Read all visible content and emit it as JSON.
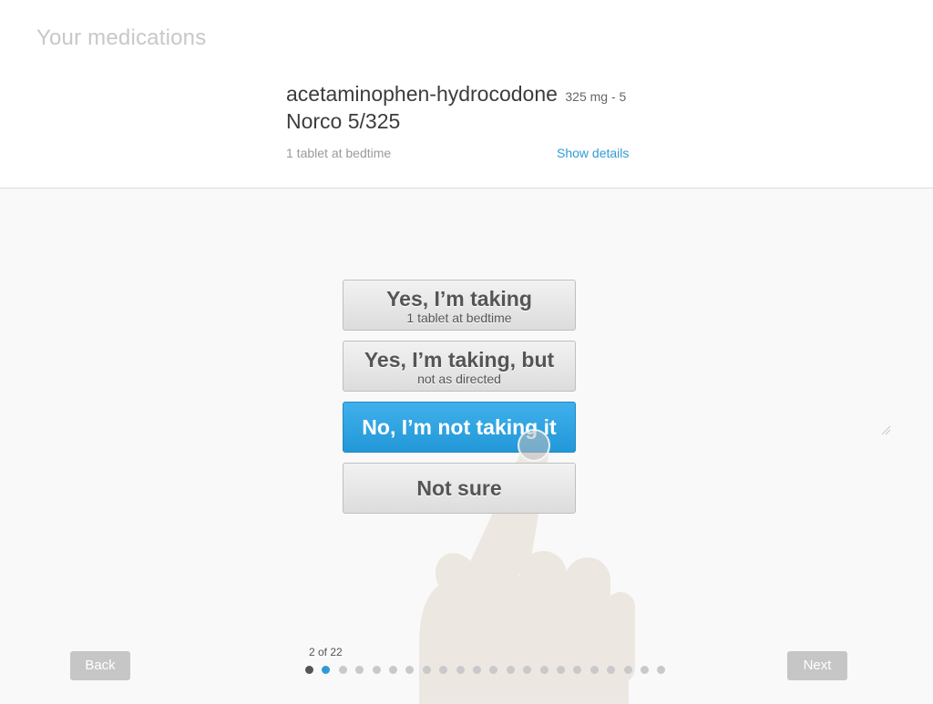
{
  "header": {
    "title": "Your medications",
    "medication": {
      "name": "acetaminophen-hydrocodone",
      "dose": "325 mg - 5",
      "brand": "Norco 5/325",
      "instructions": "1 tablet at bedtime",
      "details_link": "Show details"
    }
  },
  "options": [
    {
      "label": "Yes, I’m taking",
      "sublabel": "1 tablet at bedtime",
      "selected": false
    },
    {
      "label": "Yes, I’m taking, but",
      "sublabel": "not as directed",
      "selected": false
    },
    {
      "label": "No, I’m not taking it",
      "sublabel": "",
      "selected": true
    },
    {
      "label": "Not sure",
      "sublabel": "",
      "selected": false
    }
  ],
  "navigation": {
    "back_label": "Back",
    "next_label": "Next"
  },
  "progress": {
    "text": "2 of 22",
    "current": 2,
    "total": 22
  },
  "colors": {
    "accent": "#2f9bd6",
    "selected_button": "#2a9fe0",
    "dot_done": "#555555",
    "dot_current": "#2f9bd6",
    "dot_pending": "#c9c9c9"
  },
  "icons": {
    "hand": "hand-pointer-icon",
    "resize": "resize-handle-icon"
  }
}
